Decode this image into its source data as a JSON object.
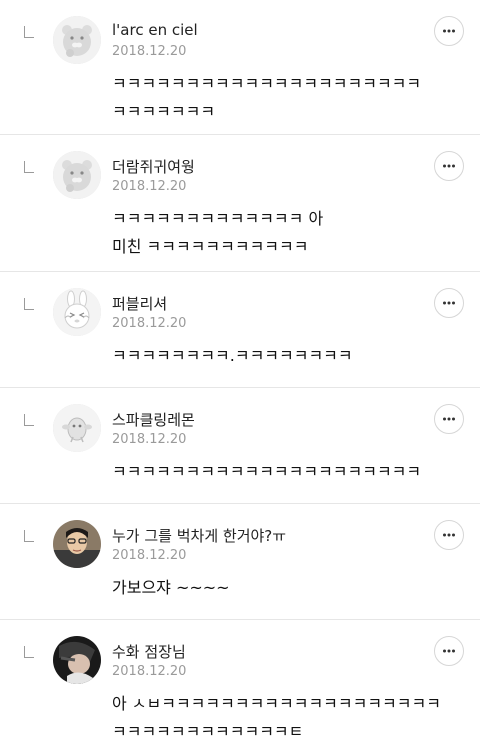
{
  "replies": [
    {
      "nickname": "l'arc en ciel",
      "date": "2018.12.20",
      "text": "ㅋㅋㅋㅋㅋㅋㅋㅋㅋㅋㅋㅋㅋㅋㅋㅋㅋㅋㅋㅋㅋ\nㅋㅋㅋㅋㅋㅋㅋ",
      "avatar": "ryan-default-avatar-icon"
    },
    {
      "nickname": "더람쥐귀여웡",
      "date": "2018.12.20",
      "text": "ㅋㅋㅋㅋㅋㅋㅋㅋㅋㅋㅋㅋㅋ 아\n미친 ㅋㅋㅋㅋㅋㅋㅋㅋㅋㅋㅋ",
      "avatar": "ryan-default-avatar-icon"
    },
    {
      "nickname": "퍼블리셔",
      "date": "2018.12.20",
      "text": "ㅋㅋㅋㅋㅋㅋㅋㅋ.ㅋㅋㅋㅋㅋㅋㅋㅋ",
      "avatar": "rabbit-avatar-icon"
    },
    {
      "nickname": "스파클링레몬",
      "date": "2018.12.20",
      "text": "ㅋㅋㅋㅋㅋㅋㅋㅋㅋㅋㅋㅋㅋㅋㅋㅋㅋㅋㅋㅋㅋ",
      "avatar": "creature-avatar-icon"
    },
    {
      "nickname": "누가 그를 벅차게 한거야?ㅠ",
      "date": "2018.12.20",
      "text": "가보으쟈 ~~~~",
      "avatar": "user-photo-avatar"
    },
    {
      "nickname": "수화 점장님",
      "date": "2018.12.20",
      "text": "아 ㅅㅂㅋㅋㅋㅋㅋㅋㅋㅋㅋㅋㅋㅋㅋㅋㅋㅋㅋㅋㅋ\nㅋㅋㅋㅋㅋㅋㅋㅋㅋㅋㅋㅋㅌ",
      "avatar": "user-photo-avatar"
    }
  ]
}
